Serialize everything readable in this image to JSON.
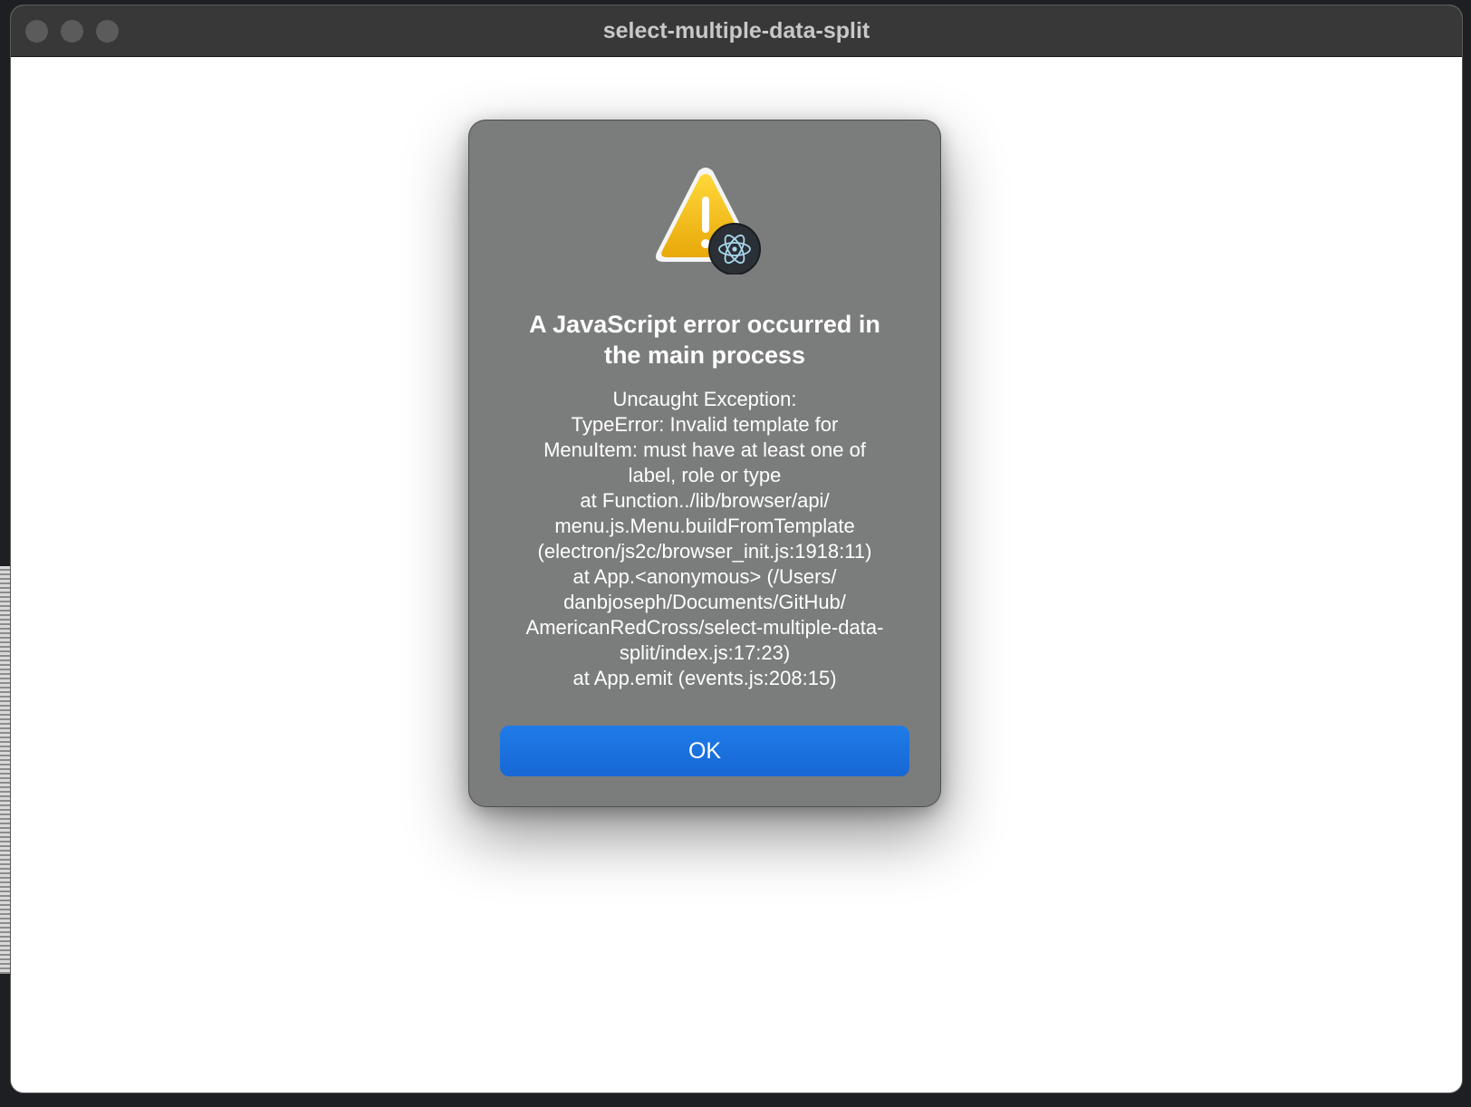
{
  "window": {
    "title": "select-multiple-data-split"
  },
  "dialog": {
    "title_lines": [
      "A JavaScript error occurred in",
      "the main process"
    ],
    "message_lines": [
      "Uncaught Exception:",
      "TypeError: Invalid template for",
      "MenuItem: must have at least one of",
      "label, role or type",
      "at Function../lib/browser/api/",
      "menu.js.Menu.buildFromTemplate",
      "(electron/js2c/browser_init.js:1918:11)",
      "at App.<anonymous> (/Users/",
      "danbjoseph/Documents/GitHub/",
      "AmericanRedCross/select-multiple-data-",
      "split/index.js:17:23)",
      "at App.emit (events.js:208:15)"
    ],
    "ok_label": "OK",
    "icon": "warning-triangle-icon",
    "badge_icon": "electron-logo-icon"
  },
  "colors": {
    "dialog_bg": "#7b7c7c",
    "button_blue": "#1a6fde",
    "warning_yellow": "#f2c10f",
    "titlebar": "#383838"
  }
}
